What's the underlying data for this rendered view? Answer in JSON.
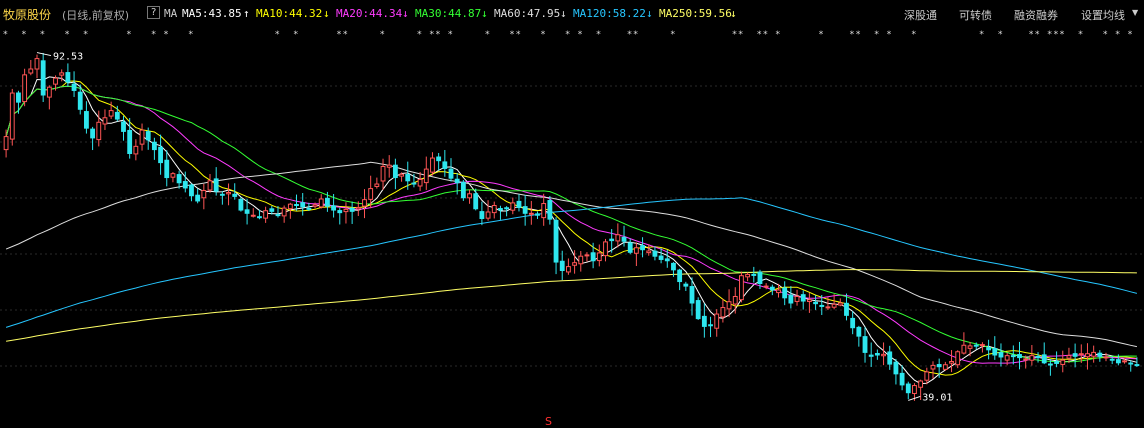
{
  "header": {
    "stock_name": "牧原股份",
    "period": "(日线,前复权)",
    "help": "?",
    "ma_label": "MA",
    "ma_items": [
      {
        "label": "MA5:43.85",
        "arrow": "↑",
        "color": "#ffffff"
      },
      {
        "label": "MA10:44.32",
        "arrow": "↓",
        "color": "#ffff00"
      },
      {
        "label": "MA20:44.34",
        "arrow": "↓",
        "color": "#ff3cff"
      },
      {
        "label": "MA30:44.87",
        "arrow": "↓",
        "color": "#33ff33"
      },
      {
        "label": "MA60:47.95",
        "arrow": "↓",
        "color": "#dddddd"
      },
      {
        "label": "MA120:58.22",
        "arrow": "↓",
        "color": "#26c6ff"
      },
      {
        "label": "MA250:59.56",
        "arrow": "↓",
        "color": "#ffff66"
      }
    ],
    "right_menu": [
      "深股通",
      "可转债",
      "融资融券",
      "设置均线"
    ],
    "settings_arrow": "▼"
  },
  "annotations": {
    "high_label": "92.53",
    "low_label": "39.01",
    "marker": "S"
  },
  "colors": {
    "up": "#ff5555",
    "down": "#2ee6ee",
    "background": "#000000"
  },
  "chart_data": {
    "type": "candlestick",
    "title": "牧原股份",
    "ylim": [
      36,
      96
    ],
    "high_marker": 92.53,
    "low_marker": 39.01,
    "closes": [
      79.6,
      86.3,
      84.9,
      89.1,
      90.0,
      91.6,
      86.0,
      87.2,
      88.6,
      89.4,
      88.0,
      86.7,
      83.8,
      80.9,
      79.4,
      81.8,
      82.5,
      83.6,
      82.3,
      80.4,
      77.0,
      78.1,
      80.6,
      79.1,
      77.6,
      75.6,
      73.3,
      73.9,
      72.5,
      71.7,
      70.5,
      69.7,
      71.3,
      72.8,
      71.2,
      70.6,
      71.0,
      70.4,
      68.3,
      67.8,
      67.5,
      67.2,
      68.2,
      68.1,
      67.5,
      68.6,
      69.2,
      69.0,
      68.8,
      68.5,
      69.1,
      70.0,
      68.9,
      68.3,
      67.9,
      68.4,
      68.1,
      68.7,
      69.9,
      71.6,
      72.3,
      75.0,
      75.2,
      73.3,
      73.8,
      72.8,
      72.3,
      73.0,
      74.6,
      76.3,
      75.9,
      74.7,
      73.2,
      72.5,
      70.2,
      70.8,
      68.5,
      67.0,
      68.0,
      69.0,
      68.3,
      68.5,
      69.4,
      68.7,
      67.8,
      67.8,
      67.5,
      69.3,
      66.9,
      60.3,
      59.0,
      59.6,
      60.2,
      61.2,
      61.4,
      60.5,
      61.7,
      63.4,
      63.6,
      64.5,
      63.5,
      61.8,
      62.5,
      62.2,
      62.0,
      61.2,
      60.7,
      60.5,
      59.1,
      57.3,
      56.6,
      54.0,
      51.6,
      50.4,
      50.6,
      52.3,
      53.3,
      54.2,
      55.0,
      58.2,
      58.4,
      58.3,
      57.0,
      56.6,
      56.0,
      56.0,
      54.8,
      54.0,
      55.0,
      54.3,
      54.5,
      53.9,
      53.6,
      53.4,
      53.8,
      54.0,
      52.1,
      50.2,
      48.9,
      46.4,
      45.8,
      46.0,
      46.1,
      44.6,
      43.1,
      41.4,
      40.2,
      41.3,
      42.0,
      43.4,
      44.4,
      44.2,
      44.5,
      45.0,
      46.5,
      47.5,
      47.4,
      47.5,
      47.6,
      46.8,
      46.0,
      45.7,
      45.9,
      45.8,
      45.6,
      45.4,
      45.9,
      45.6,
      44.8,
      44.5,
      44.7,
      45.2,
      45.9,
      45.8,
      46.2,
      46.2,
      46.4,
      45.8,
      45.7,
      45.3,
      44.8,
      45.1,
      44.7,
      44.5
    ],
    "ma": [
      {
        "name": "MA5",
        "value": 43.85,
        "color": "#ffffff"
      },
      {
        "name": "MA10",
        "value": 44.32,
        "color": "#ffff00"
      },
      {
        "name": "MA20",
        "value": 44.34,
        "color": "#ff3cff"
      },
      {
        "name": "MA30",
        "value": 44.87,
        "color": "#33ff33"
      },
      {
        "name": "MA60",
        "value": 47.95,
        "color": "#dddddd"
      },
      {
        "name": "MA120",
        "value": 58.22,
        "color": "#26c6ff"
      },
      {
        "name": "MA250",
        "value": 59.56,
        "color": "#ffff66"
      }
    ]
  }
}
